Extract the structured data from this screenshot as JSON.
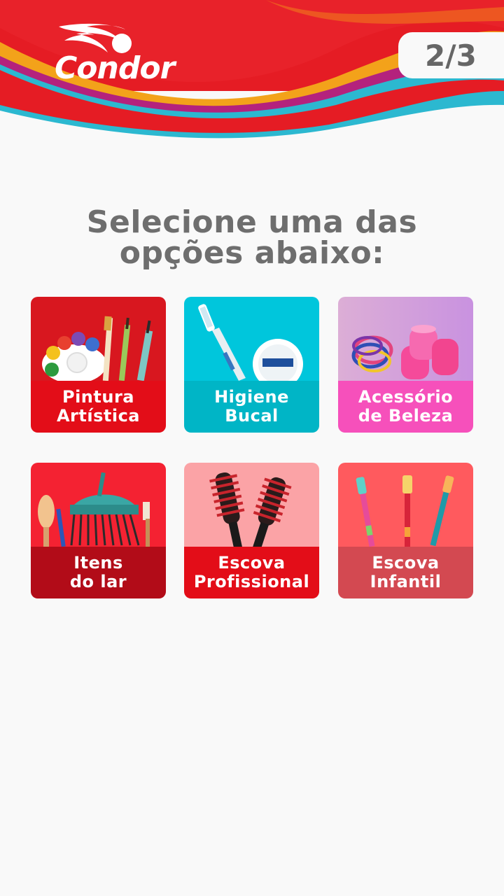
{
  "brand": {
    "name": "Condor"
  },
  "progress": {
    "text": "2/3",
    "current": 2,
    "total": 3
  },
  "heading": {
    "line1": "Selecione uma das",
    "line2": "opções abaixo:"
  },
  "colors": {
    "brand_red": "#e41b23",
    "title_gray": "#6e6e6e"
  },
  "options": [
    {
      "label": "Pintura\nArtística",
      "icon": "paint-palette-brushes",
      "bg": "#e8161f",
      "band": "#e30d18"
    },
    {
      "label": "Higiene\nBucal",
      "icon": "toothbrush-dental-floss",
      "bg": "#00c6dc",
      "band": "#00b5c6"
    },
    {
      "label": "Acessório\nde Beleza",
      "icon": "hair-rollers-elastics",
      "bg": "#d9a3dc",
      "band": "#f650bb"
    },
    {
      "label": "Itens\ndo lar",
      "icon": "broom-cleaning-brushes",
      "bg": "#f42232",
      "band": "#b20c18"
    },
    {
      "label": "Escova\nProfissional",
      "icon": "round-hair-brushes",
      "bg": "#fba3a6",
      "band": "#e30d18"
    },
    {
      "label": "Escova\nInfantil",
      "icon": "kids-toothbrushes",
      "bg": "#ff5a5e",
      "band": "#d34951"
    }
  ]
}
